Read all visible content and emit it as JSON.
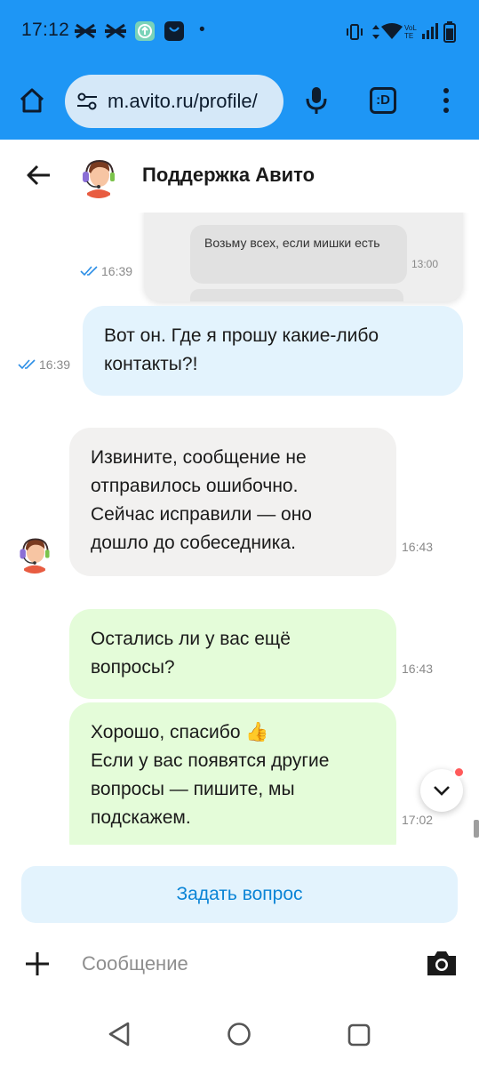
{
  "status_bar": {
    "time": "17:12",
    "dot": "•",
    "network_label": "VoLTE"
  },
  "browser": {
    "url": "m.avito.ru/profile/",
    "icons": [
      "home-icon",
      "site-settings-icon",
      "microphone-icon",
      "tab-switcher-icon",
      "overflow-menu-icon"
    ],
    "tab_badge": ":D"
  },
  "chat": {
    "title": "Поддержка Авито",
    "messages": [
      {
        "type": "image",
        "time": "16:39",
        "read": true,
        "image_text": "Возьму всех, если мишки есть",
        "image_time": "13:00"
      },
      {
        "type": "outgoing",
        "text": "Вот он. Где я прошу какие-либо контакты?!",
        "time": "16:39",
        "read": true
      },
      {
        "type": "incoming",
        "text": "Извините, сообщение не отправилось ошибочно. Сейчас исправили — оно дошло до собеседника.",
        "time": "16:43"
      },
      {
        "type": "incoming-green",
        "text": "Остались ли у вас ещё вопросы?",
        "time": "16:43"
      },
      {
        "type": "incoming-green",
        "text": "Хорошо, спасибо 👍\nЕсли у вас появятся другие вопросы — пишите, мы подскажем.",
        "time": "17:02"
      }
    ]
  },
  "ask_button_label": "Задать вопрос",
  "composer": {
    "placeholder": "Сообщение"
  },
  "colors": {
    "browser_bar": "#1e96f5",
    "outgoing_bubble": "#e3f3fd",
    "incoming_bubble": "#f2f1f0",
    "green_bubble": "#e4fcd9",
    "accent_blue": "#0a84d6",
    "notification_dot": "#ff5a5a"
  }
}
